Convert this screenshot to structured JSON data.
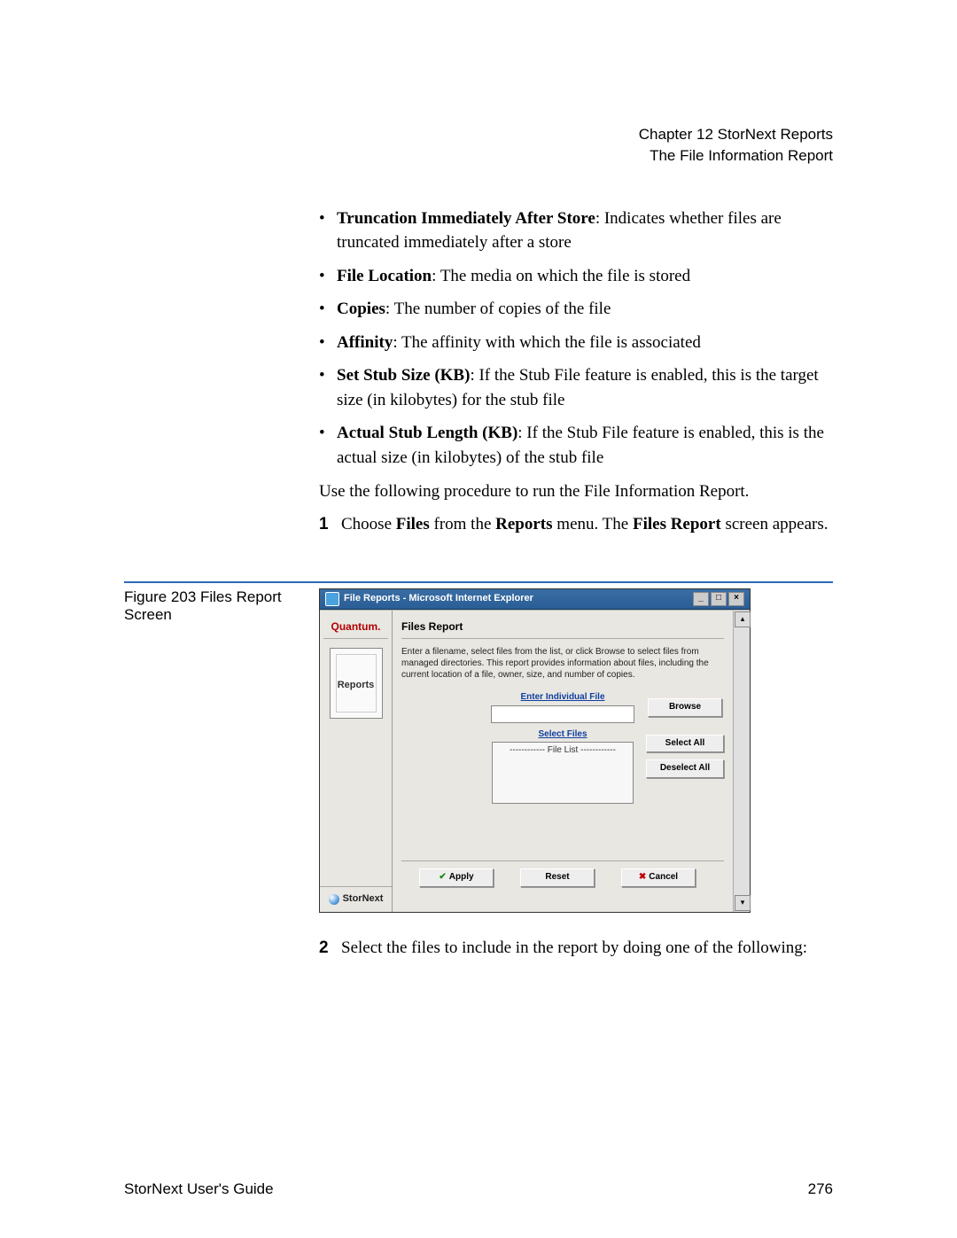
{
  "header": {
    "chapter": "Chapter 12  StorNext Reports",
    "section": "The File Information Report"
  },
  "bullets": [
    {
      "term": "Truncation Immediately After Store",
      "desc": ": Indicates whether files are truncated immediately after a store"
    },
    {
      "term": "File Location",
      "desc": ": The media on which the file is stored"
    },
    {
      "term": "Copies",
      "desc": ": The number of copies of the file"
    },
    {
      "term": "Affinity",
      "desc": ": The affinity with which the file is associated"
    },
    {
      "term": "Set Stub Size (KB)",
      "desc": ": If the Stub File feature is enabled, this is the target size (in kilobytes) for the stub file"
    },
    {
      "term": "Actual Stub Length (KB)",
      "desc": ": If the Stub File feature is enabled, this is the actual size (in kilobytes) of the stub file"
    }
  ],
  "intro": "Use the following procedure to run the File Information Report.",
  "step1": {
    "num": "1",
    "pre": "Choose ",
    "b1": "Files",
    "mid": " from the ",
    "b2": "Reports",
    "mid2": " menu. The ",
    "b3": "Files Report",
    "post": " screen appears."
  },
  "figure_caption": "Figure 203  Files Report Screen",
  "window": {
    "title": "File Reports - Microsoft Internet Explorer",
    "brand": "Quantum.",
    "sidebar_book": "Reports",
    "sidebar_product": "StorNext",
    "panel_title": "Files Report",
    "panel_desc": "Enter a filename, select files from the list, or click Browse to select files from managed directories. This report provides information about files, including the current location of a file, owner, size, and number of copies.",
    "label_individual": "Enter Individual File",
    "label_select": "Select Files",
    "filelist_placeholder": "------------ File List ------------",
    "btn_browse": "Browse",
    "btn_select_all": "Select All",
    "btn_deselect_all": "Deselect All",
    "btn_apply": "Apply",
    "btn_reset": "Reset",
    "btn_cancel": "Cancel"
  },
  "step2": {
    "num": "2",
    "text": "Select the files to include in the report by doing one of the following:"
  },
  "footer": {
    "left": "StorNext User's Guide",
    "right": "276"
  }
}
